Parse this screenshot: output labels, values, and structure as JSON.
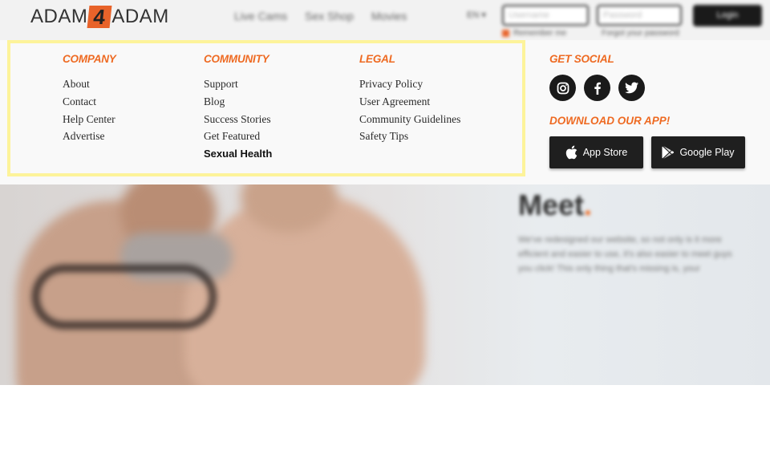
{
  "header": {
    "logo_left": "ADAM",
    "logo_number": "4",
    "logo_right": "ADAM",
    "nav": [
      "Live Cams",
      "Sex Shop",
      "Movies"
    ],
    "language": "EN",
    "username_placeholder": "Username",
    "password_placeholder": "Password",
    "login_label": "Login",
    "remember_label": "Remember me",
    "forgot_label": "Forgot your password"
  },
  "footer_menu": {
    "company": {
      "title": "COMPANY",
      "links": [
        "About",
        "Contact",
        "Help Center",
        "Advertise"
      ]
    },
    "community": {
      "title": "COMMUNITY",
      "links": [
        "Support",
        "Blog",
        "Success Stories",
        "Get Featured",
        "Sexual Health"
      ]
    },
    "legal": {
      "title": "LEGAL",
      "links": [
        "Privacy Policy",
        "User Agreement",
        "Community Guidelines",
        "Safety Tips"
      ]
    },
    "social": {
      "title": "GET SOCIAL",
      "icons": [
        "instagram-icon",
        "facebook-icon",
        "twitter-icon"
      ]
    },
    "app": {
      "title": "DOWNLOAD OUR APP!",
      "app_store_label": "App Store",
      "google_play_label": "Google Play"
    }
  },
  "hero": {
    "heading": "Meet",
    "heading_dot": ".",
    "text": "We've redesigned our website, so not only is it more efficient and easier to use, it's also easier to meet guys you click! This only thing that's missing is, your"
  },
  "colors": {
    "accent": "#ee6a22",
    "highlight": "#fdf39a",
    "dark": "#1a1a1a"
  }
}
